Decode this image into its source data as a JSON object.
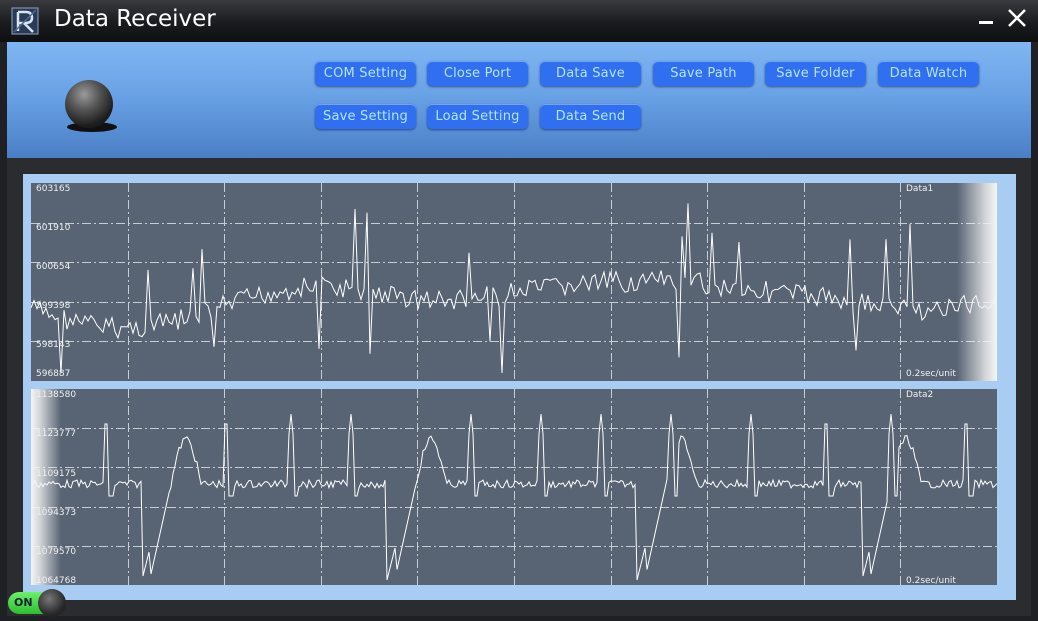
{
  "window": {
    "title": "Data Receiver"
  },
  "toolbar": {
    "buttons": [
      "COM Setting",
      "Close Port",
      "Data Save",
      "Save Path",
      "Save Folder",
      "Data Watch",
      "Save Setting",
      "Load Setting",
      "Data Send"
    ]
  },
  "toggle": {
    "label": "ON",
    "state": "on"
  },
  "colors": {
    "toolbar_button": "#2f6ff0",
    "toolbar_text": "#b5e4ff",
    "plot_bg": "#586474",
    "trace": "#ffffff",
    "toggle_on": "#4bd64b"
  },
  "chart_data": [
    {
      "type": "line",
      "series": [
        {
          "name": "Data1"
        }
      ],
      "ytick_labels": [
        "603165",
        "601910",
        "600654",
        "599398",
        "598143",
        "596887"
      ],
      "ylim": [
        596887,
        603165
      ],
      "unit_label": "0.2sec/unit",
      "grid": true
    },
    {
      "type": "line",
      "series": [
        {
          "name": "Data2"
        }
      ],
      "ytick_labels": [
        "1138580",
        "1123777",
        "1109175",
        "1094373",
        "1079570",
        "1064768"
      ],
      "ylim": [
        1064768,
        1138580
      ],
      "unit_label": "0.2sec/unit",
      "grid": true
    }
  ]
}
